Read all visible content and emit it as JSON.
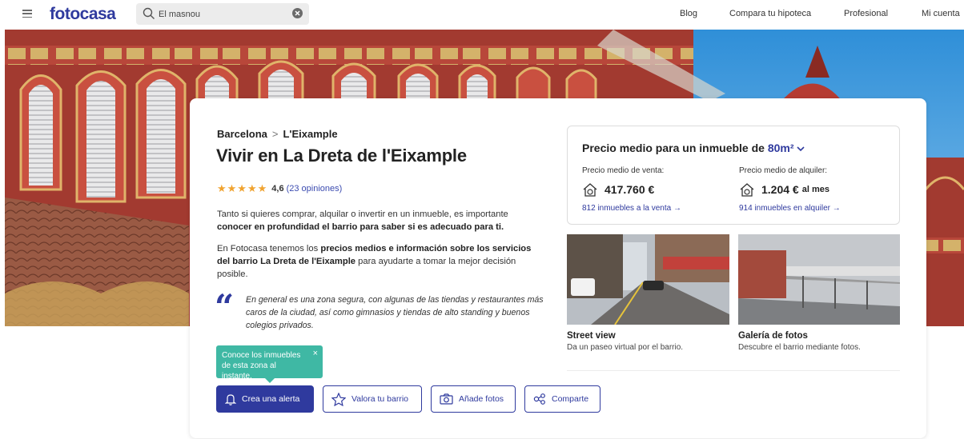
{
  "header": {
    "logo": "fotocasa",
    "search_value": "El masnou",
    "nav": [
      "Blog",
      "Compara tu hipoteca",
      "Profesional",
      "Mi cuenta"
    ]
  },
  "hero": {
    "image": "market-facade-photo"
  },
  "breadcrumb": {
    "parent": "Barcelona",
    "separator": ">",
    "current": "L'Eixample"
  },
  "page_title": "Vivir en La Dreta de l'Eixample",
  "rating": {
    "stars": "★★★★★",
    "stars_value": 4.6,
    "score": "4,6",
    "opinions": "(23 opiniones)"
  },
  "intro": {
    "p1_a": "Tanto si quieres comprar, alquilar o invertir en un inmueble, es importante ",
    "p1_b": "conocer en profundidad el barrio para saber si es adecuado para ti.",
    "p2_a": "En Fotocasa tenemos los ",
    "p2_b": "precios medios e información sobre los servicios del barrio La Dreta de l'Eixample",
    "p2_c": " para ayudarte a tomar la mejor decisión posible."
  },
  "quote": {
    "mark": "“",
    "text": "En general es una zona segura, con algunas de las tiendas y restaurantes más caros de la ciudad, así como gimnasios y tiendas de alto standing y buenos colegios privados."
  },
  "prices": {
    "heading": "Precio medio para un inmueble de ",
    "size": "80m²",
    "sale": {
      "label": "Precio medio de venta:",
      "value": "417.760 €",
      "suffix": "",
      "link": "812 inmuebles a la venta →"
    },
    "rent": {
      "label": "Precio medio de alquiler:",
      "value": "1.204 €",
      "suffix": "al mes",
      "link": "914 inmuebles en alquiler →"
    }
  },
  "media": {
    "street": {
      "title": "Street view",
      "desc": "Da un paseo virtual por el barrio."
    },
    "gallery": {
      "title": "Galería de fotos",
      "desc": "Descubre el barrio mediante fotos."
    }
  },
  "tooltip": {
    "text": "Conoce los inmuebles de esta zona al instante.",
    "close": "×"
  },
  "actions": {
    "alert": "Crea una alerta",
    "rate": "Valora tu barrio",
    "photos": "Añade fotos",
    "share": "Comparte"
  },
  "colors": {
    "brand": "#2f3a9e",
    "accent_star": "#f0a330",
    "tooltip": "#3fb8a4"
  }
}
